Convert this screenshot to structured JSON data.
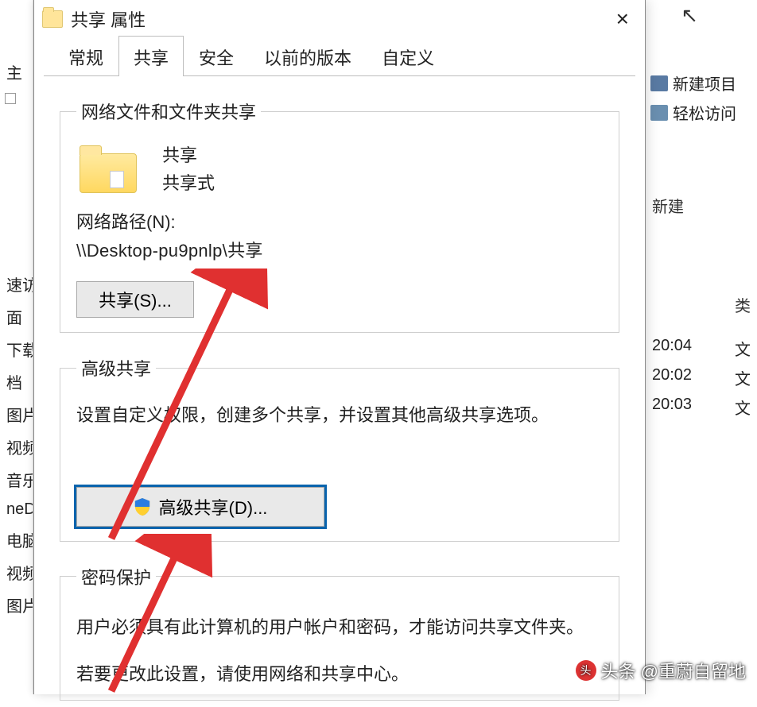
{
  "dialog": {
    "title": "共享 属性",
    "close_char": "×",
    "tabs": [
      {
        "label": "常规",
        "active": false
      },
      {
        "label": "共享",
        "active": true
      },
      {
        "label": "安全",
        "active": false
      },
      {
        "label": "以前的版本",
        "active": false
      },
      {
        "label": "自定义",
        "active": false
      }
    ],
    "section_network": {
      "legend": "网络文件和文件夹共享",
      "name": "共享",
      "status": "共享式",
      "path_label": "网络路径(N):",
      "path_value": "\\\\Desktop-pu9pnlp\\共享",
      "share_button": "共享(S)..."
    },
    "section_advanced": {
      "legend": "高级共享",
      "description": "设置自定义权限，创建多个共享，并设置其他高级共享选项。",
      "button": "高级共享(D)..."
    },
    "section_password": {
      "legend": "密码保护",
      "description": "用户必须具有此计算机的用户帐户和密码，才能访问共享文件夹。",
      "cutoff_row": "若要更改此设置，请使用网络和共享中心。"
    }
  },
  "background": {
    "left_char": "主",
    "left_items": [
      "速访",
      "面",
      "下载",
      "档",
      "图片",
      "视频",
      "音乐",
      "neD",
      "电脑",
      "视频",
      "图片"
    ],
    "ribbon_items": [
      "新建项目",
      "轻松访问"
    ],
    "ribbon_group": "新建",
    "column_header": "类",
    "rows": [
      {
        "time": "20:04",
        "type": "文"
      },
      {
        "time": "20:02",
        "type": "文"
      },
      {
        "time": "20:03",
        "type": "文"
      }
    ]
  },
  "watermark": "头条 @重蔚自留地"
}
